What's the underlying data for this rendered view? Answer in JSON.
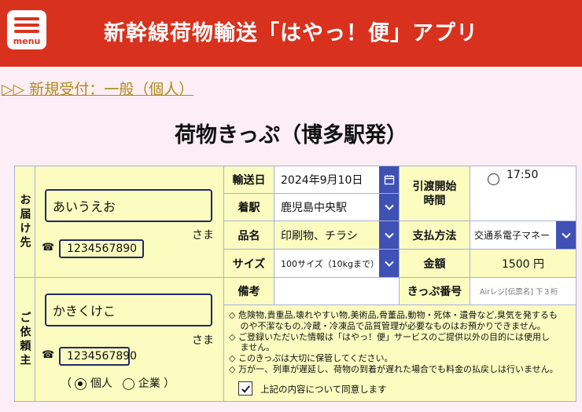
{
  "header": {
    "menu_label": "menu",
    "title": "新幹線荷物輸送「はやっ！便」アプリ"
  },
  "breadcrumb": "▷▷ 新規受付：一般（個人）",
  "page_title": "荷物きっぷ（博多駅発）",
  "recipient": {
    "section_label": "お届け先",
    "name": "あいうえお",
    "honorific": "さま",
    "phone": "1234567890"
  },
  "sender": {
    "section_label": "ご依頼主",
    "name": "かきくけこ",
    "honorific": "さま",
    "phone": "1234567890",
    "type_open": "（",
    "type_close": "）",
    "type_options": [
      "個人",
      "企業"
    ],
    "selected_type": "個人"
  },
  "shipment": {
    "date_label": "輸送日",
    "date_value": "2024年9月10日",
    "station_label": "着駅",
    "station_value": "鹿児島中央駅",
    "item_label": "品名",
    "item_value": "印刷物、チラシ",
    "size_label": "サイズ",
    "size_value": "100サイズ（10kgまで）",
    "remarks_label": "備考",
    "remarks_value": ""
  },
  "handover": {
    "label_line1": "引渡開始",
    "label_line2": "時間",
    "time_value": "17:50"
  },
  "payment": {
    "label": "支払方法",
    "value": "交通系電子マネー"
  },
  "amount": {
    "label": "金額",
    "value": "1500 円"
  },
  "ticket": {
    "label": "きっぷ番号",
    "placeholder": "Airレジ[伝票名] 下３桁"
  },
  "notices": [
    "◇ 危険物,貴重品,壊れやすい物,美術品,骨董品,動物・死体・遺骨など,臭気を発するも",
    "　 のや不潔なもの,冷蔵・冷凍品で品質管理が必要なものはお預かりできません。",
    "◇ ご登録いただいた情報は「はやっ！便」サービスのご提供以外の目的には使用し",
    "　 ません。",
    "◇ このきっぷは大切に保管してください。",
    "◇ 万が一、列車が遅延し、荷物の到着が遅れた場合でも料金の払戻しは行いません。"
  ],
  "agreement": {
    "label": "上記の内容について同意します",
    "checked": true
  },
  "colors": {
    "header_bg": "#d8321e",
    "page_bg": "#fbeef4",
    "field_yellow": "#fcfcc0",
    "dropdown_blue": "#3f51b5",
    "breadcrumb": "#b28a1e"
  }
}
